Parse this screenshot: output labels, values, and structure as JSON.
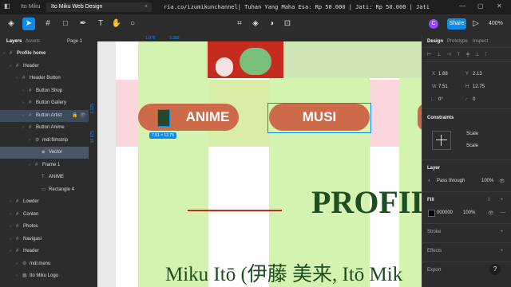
{
  "titlebar": {
    "tab_inactive": "Ito Miku",
    "tab_active": "Ito Miku Web Design",
    "marquee": "ria.co/izumikunchannel| Tuhan Yang Maha Esa: Rp 50.000 | Jati: Rp 50.000 | Jati"
  },
  "toolbar": {
    "avatar_letter": "C",
    "share_label": "Share",
    "zoom": "400%"
  },
  "left_panel": {
    "tab_layers": "Layers",
    "tab_assets": "Assets",
    "page_label": "Page 1",
    "layers": [
      {
        "label": "Profile home"
      },
      {
        "label": "Header"
      },
      {
        "label": "Header Button"
      },
      {
        "label": "Button Shop"
      },
      {
        "label": "Button Gallery"
      },
      {
        "label": "Button Artist"
      },
      {
        "label": "Button Anime"
      },
      {
        "label": "mdi:filmstrip"
      },
      {
        "label": "Vector"
      },
      {
        "label": "Frame 1"
      },
      {
        "label": "ANIME"
      },
      {
        "label": "Rectangle 4"
      },
      {
        "label": "Lowder"
      },
      {
        "label": "Conten"
      },
      {
        "label": "Photos"
      },
      {
        "label": "Navigasi"
      },
      {
        "label": "Header"
      },
      {
        "label": "mdi:menu"
      },
      {
        "label": "Ito Miku Logo"
      }
    ]
  },
  "rulers": {
    "top_marks": [
      "1.878",
      "9.388"
    ],
    "left_marks": [
      "2.125",
      "14.875"
    ]
  },
  "canvas": {
    "button_anime": "ANIME",
    "button_music": "MUSI",
    "selection_size": "7.51 × 12.75",
    "profile_heading": "PROFII",
    "name_line": "Miku Itō (伊藤 美来, Itō Mik"
  },
  "right_panel": {
    "tab_design": "Design",
    "tab_prototype": "Prototype",
    "tab_inspect": "Inspect",
    "x_label": "X",
    "x_value": "1.88",
    "y_label": "Y",
    "y_value": "2.13",
    "w_label": "W",
    "w_value": "7.51",
    "h_label": "H",
    "h_value": "12.75",
    "rotation": "0°",
    "radius": "0",
    "constraints_title": "Constraints",
    "constraint_h": "Scale",
    "constraint_v": "Scale",
    "layer_title": "Layer",
    "blend_mode": "Pass through",
    "layer_opacity": "100%",
    "fill_title": "Fill",
    "fill_hex": "000000",
    "fill_opacity": "100%",
    "stroke_title": "Stroke",
    "effects_title": "Effects",
    "export_title": "Export"
  },
  "colors": {
    "accent": "#0c8ce9",
    "button": "#cd6a4a",
    "heading": "#1e4d1f"
  }
}
